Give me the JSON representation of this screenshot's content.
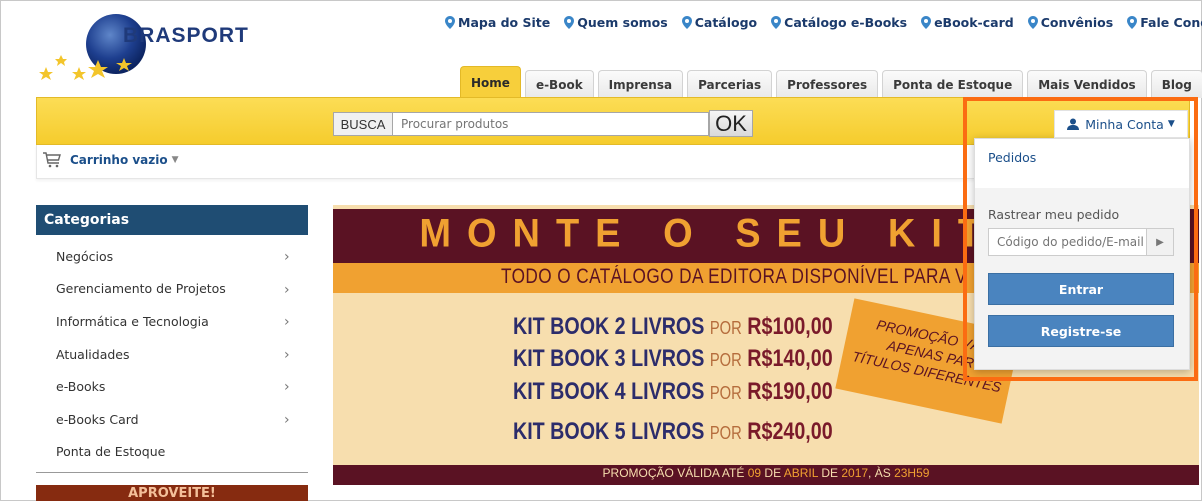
{
  "brand": {
    "logo_text": "BRASPORT"
  },
  "top_links": [
    {
      "label": "Mapa do Site"
    },
    {
      "label": "Quem somos"
    },
    {
      "label": "Catálogo"
    },
    {
      "label": "Catálogo e-Books"
    },
    {
      "label": "eBook-card"
    },
    {
      "label": "Convênios"
    },
    {
      "label": "Fale Conosco"
    }
  ],
  "tabs": [
    {
      "label": "Home",
      "active": true
    },
    {
      "label": "e-Book"
    },
    {
      "label": "Imprensa"
    },
    {
      "label": "Parcerias"
    },
    {
      "label": "Professores"
    },
    {
      "label": "Ponta de Estoque"
    },
    {
      "label": "Mais Vendidos"
    },
    {
      "label": "Blog"
    }
  ],
  "search": {
    "label": "BUSCA",
    "placeholder": "Procurar produtos",
    "button": "OK"
  },
  "cart": {
    "label": "Carrinho vazio"
  },
  "sidebar": {
    "title": "Categorias",
    "items": [
      {
        "label": "Negócios"
      },
      {
        "label": "Gerenciamento de Projetos"
      },
      {
        "label": "Informática e Tecnologia"
      },
      {
        "label": "Atualidades"
      },
      {
        "label": "e-Books"
      },
      {
        "label": "e-Books Card"
      },
      {
        "label": "Ponta de Estoque"
      }
    ],
    "promo_title": "APROVEITE!"
  },
  "banner": {
    "title": "MONTE O SEU KIT BO",
    "subtitle": "TODO O CATÁLOGO DA EDITORA DISPONÍVEL PARA V",
    "offers": [
      {
        "label": "KIT BOOK 2 LIVROS",
        "por": "POR",
        "price": "R$100,00"
      },
      {
        "label": "KIT BOOK 3 LIVROS",
        "por": "POR",
        "price": "R$140,00"
      },
      {
        "label": "KIT BOOK 4 LIVROS",
        "por": "POR",
        "price": "R$190,00"
      },
      {
        "label": "KIT BOOK 5 LIVROS",
        "por": "POR",
        "price": "R$240,00"
      }
    ],
    "promo_lines": [
      "PROMOÇÃO VÁLI",
      "APENAS PAR",
      "TÍTULOS DIFERENTES"
    ],
    "footer": {
      "p1": "PROMOÇÃO VÁLIDA ATÉ ",
      "day": "09",
      "p2": " DE ",
      "month": "ABRIL",
      "p3": " DE ",
      "year": "2017",
      "p4": ", ÀS ",
      "time": "23H59"
    }
  },
  "account": {
    "button_label": "Minha Conta",
    "menu_pedidos": "Pedidos",
    "track_label": "Rastrear meu pedido",
    "track_placeholder": "Código do pedido/E-mail",
    "login_button": "Entrar",
    "register_button": "Registre-se"
  },
  "colors": {
    "highlight_border": "#fb6c12",
    "banner_maroon": "#5a1223",
    "banner_orange": "#f0a131",
    "sidebar_header": "#1f4d73",
    "yellow_bar": "#f5cc2d",
    "button_blue": "#4a84bf"
  },
  "icons": [
    "map-pin-icon",
    "cart-icon",
    "user-icon",
    "chevron-right-icon",
    "caret-down-icon",
    "play-arrow-icon"
  ]
}
